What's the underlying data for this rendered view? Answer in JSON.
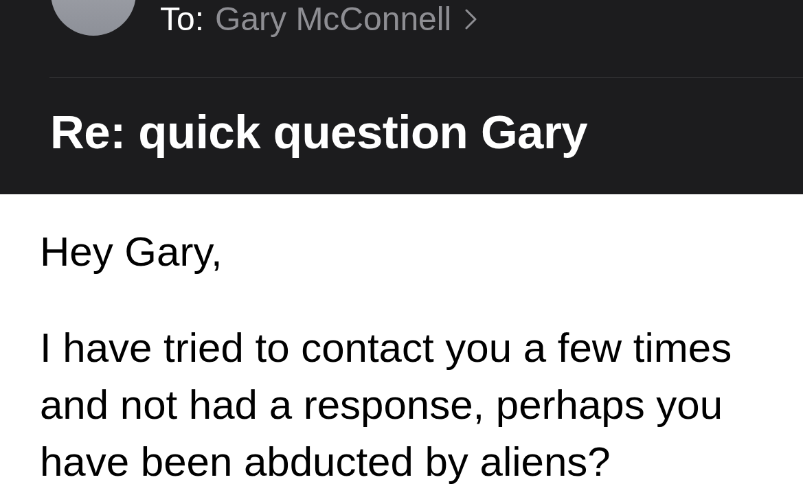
{
  "header": {
    "to_label": "To:",
    "recipient": "Gary McConnell",
    "subject": "Re: quick question Gary"
  },
  "body": {
    "paragraphs": [
      {
        "lines": [
          "Hey Gary,"
        ]
      },
      {
        "lines": [
          "I have tried to contact you a few times",
          "and not had a response, perhaps you",
          "have been abducted by aliens?"
        ]
      }
    ]
  }
}
